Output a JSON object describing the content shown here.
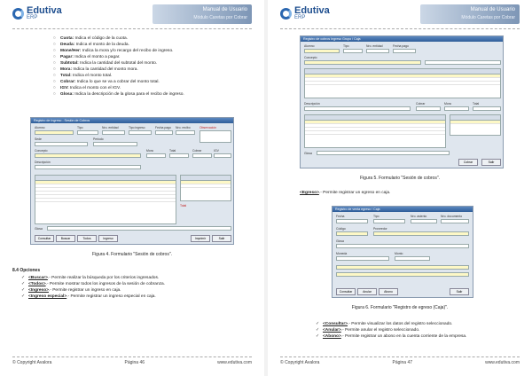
{
  "header": {
    "brand": "Edutiva",
    "brand_sub": "ERP",
    "banner_title": "Manual de Usuario",
    "banner_sub": "Módulo Caretas por Cobrar"
  },
  "left_page": {
    "bullets": [
      {
        "term": "Cuota:",
        "text": " Indica el código de la cuota."
      },
      {
        "term": "Deuda:",
        "text": " Indica el monto de la deuda."
      },
      {
        "term": "Mone/Her:",
        "text": " Indica la mora y/o recargo del recibo de ingreso."
      },
      {
        "term": "Pagar:",
        "text": " Indica el monto a pagar."
      },
      {
        "term": "Subtotal:",
        "text": " Indica la cantidad del subtotal del monto."
      },
      {
        "term": "Mora:",
        "text": " Indica la cantidad del monto mora."
      },
      {
        "term": "Total:",
        "text": " Indica el monto total."
      },
      {
        "term": "Cobrar:",
        "text": " Indica lo que se va a cobrar del monto total."
      },
      {
        "term": "IGV:",
        "text": " Indica el monto con el IGV."
      },
      {
        "term": "Glosa:",
        "text": " Indica la descripción de la glosa para el recibo de ingreso."
      }
    ],
    "shot": {
      "title": "Registro de Ingreso - Sesión de Cobros",
      "labels": [
        "Alumno",
        "Tipo",
        "Nro. entidad",
        "Tipo ingreso",
        "Fecha pago",
        "Nro. recibo",
        "Sede",
        "Periodo",
        "Concepto",
        "Descripción",
        "Mora",
        "Total",
        "Cobrar",
        "IGV",
        "Glosa"
      ],
      "red_labels": [
        "Observación",
        "Total"
      ],
      "buttons": [
        "Consultar",
        "Buscar",
        "Todos",
        "Ingreso",
        "Imprimir",
        "Salir"
      ]
    },
    "caption": "Figura 4. Formulario \"Sesión de cobros\".",
    "section_title": "8.4 Opciones",
    "options": [
      {
        "term": "<Buscar>",
        "text": ".- Permite realizar la búsqueda por los criterios ingresados."
      },
      {
        "term": "<Todos>",
        "text": ".- Permite mostrar todos los ingresos de la sesión de cobranza."
      },
      {
        "term": "<Ingreso>",
        "text": ".- Permite registrar un ingreso en caja."
      },
      {
        "term": "<Ingreso especial>",
        "text": ".- Permite registrar un ingreso especial en caja."
      }
    ],
    "footer": {
      "left": "© Copyright Avalora",
      "center": "Página 46",
      "right": "www.edutiva.com"
    }
  },
  "right_page": {
    "shot1": {
      "title": "Registro de cobros Ingreso Grupo / Caja",
      "labels": [
        "Alumno",
        "Tipo",
        "Nro. entidad",
        "Fecha pago",
        "Concepto",
        "Descripción",
        "Cobrar",
        "Mora",
        "Total",
        "Glosa"
      ],
      "buttons": [
        "Cobrar",
        "Salir"
      ]
    },
    "caption1": "Figura 5. Formulario \"Sesión de cobros\".",
    "line1": {
      "term": "<Egreso>",
      "text": ".- Permite registrar un egreso en caja."
    },
    "shot2": {
      "title": "Registro de venta egreso / Caja",
      "labels": [
        "Fecha",
        "Tipo",
        "Nro. asiento",
        "Nro. documento",
        "Código",
        "Proveedor",
        "Glosa",
        "Moneda",
        "Monto"
      ],
      "buttons": [
        "Consultar",
        "Anular",
        "Abono",
        "Salir"
      ]
    },
    "caption2": "Figura 6. Formulario \"Registro de egreso (Caja)\".",
    "options": [
      {
        "term": "<Consultar>",
        "text": ".- Permite visualizar los datos del registro seleccionado."
      },
      {
        "term": "<Anular>",
        "text": ".- Permite anular el registro seleccionado."
      },
      {
        "term": "<Abono>",
        "text": ".- Permite registrar un abono en la cuenta corriente de la empresa."
      }
    ],
    "footer": {
      "left": "© Copyright Avalora",
      "center": "Página 47",
      "right": "www.edutiva.com"
    }
  },
  "icons": {
    "bullet": "circle-bullet",
    "check": "check-mark"
  }
}
